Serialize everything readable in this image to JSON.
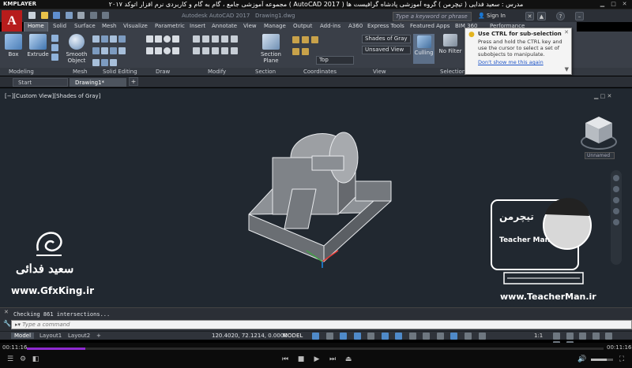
{
  "player": {
    "brand": "KMPLAYER",
    "title": "مجموعه آموزشی جامع ، گام به گام و کاربردی نرم افزار اتوکد ۲۰۱۷ ( AutoCAD 2017 ) مدرس : سعید فدایی ( تیچرمن ) گروه آموزشی پادشاه گرافیست ها",
    "time_current": "00:11:16",
    "time_total": "00:11:16"
  },
  "acad": {
    "app_title": "Autodesk AutoCAD 2017",
    "doc_title": "Drawing1.dwg",
    "search_placeholder": "Type a keyword or phrase",
    "signin": "Sign In",
    "logo": "A"
  },
  "ribbon_tabs": [
    "Home",
    "Solid",
    "Surface",
    "Mesh",
    "Visualize",
    "Parametric",
    "Insert",
    "Annotate",
    "View",
    "Manage",
    "Output",
    "Add-ins",
    "A360",
    "Express Tools",
    "Featured Apps",
    "BIM 360",
    "Performance"
  ],
  "ribbon": {
    "box": "Box",
    "extrude": "Extrude",
    "smooth_object_1": "Smooth",
    "smooth_object_2": "Object",
    "section_plane_1": "Section",
    "section_plane_2": "Plane",
    "visual_style": "Shades of Gray",
    "view_saved": "Unsaved View",
    "view_direction": "Top",
    "culling": "Culling",
    "no_filter": "No Filter"
  },
  "panels": [
    "Modeling",
    "Mesh",
    "Solid Editing",
    "Draw",
    "Modify",
    "Section",
    "Coordinates",
    "View",
    "Selection"
  ],
  "tooltip": {
    "heading": "Use CTRL for sub-selection",
    "body": "Press and hold the CTRL key and use the cursor to select a set of subobjects to manipulate.",
    "link": "Don't show me this again"
  },
  "doc_tabs": [
    "Start",
    "Drawing1*"
  ],
  "viewport": {
    "label": "[−][Custom View][Shades of Gray]",
    "viewcube_label": "Unnamed"
  },
  "command": {
    "history": "Checking 861 intersections...",
    "placeholder": "Type a command"
  },
  "status": {
    "tabs": [
      "Model",
      "Layout1",
      "Layout2"
    ],
    "coords": "120.4020, 72.1214, 0.0000",
    "mode": "MODEL",
    "scale": "1:1"
  },
  "watermarks": {
    "author": "سعید فدائی",
    "site1": "www.GfxKing.ir",
    "site2": "www.TeacherMan.ir",
    "logo_text": "تیچرمن",
    "teacher": "Teacher Man"
  }
}
